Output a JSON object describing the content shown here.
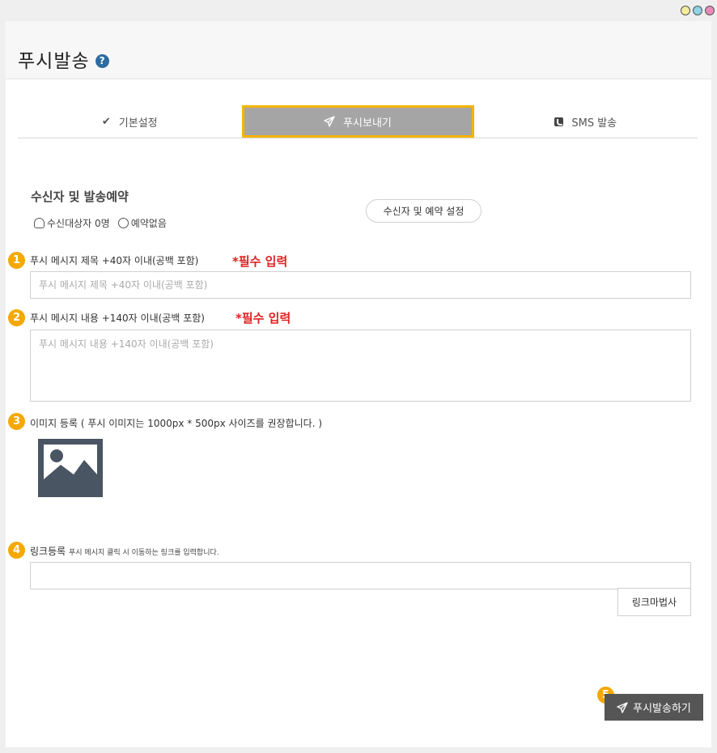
{
  "page": {
    "title": "푸시발송",
    "help_icon": "question-circle-icon"
  },
  "tabs": [
    {
      "label": "기본설정",
      "icon": "check-icon",
      "active": false
    },
    {
      "label": "푸시보내기",
      "icon": "paper-plane-icon",
      "active": true
    },
    {
      "label": "SMS 발송",
      "icon": "phone-icon",
      "active": false
    }
  ],
  "recipients": {
    "title": "수신자 및 발송예약",
    "target_count": "수신대상자 0명",
    "reservation": "예약없음",
    "settings_button": "수신자 및 예약 설정"
  },
  "fields": {
    "title": {
      "badge": "1",
      "label": "푸시 메시지 제목 +40자 이내(공백 포함)",
      "required": "*필수 입력",
      "placeholder": "푸시 메시지 제목 +40자 이내(공백 포함)",
      "value": ""
    },
    "content": {
      "badge": "2",
      "label": "푸시 메시지 내용 +140자 이내(공백 포함)",
      "required": "*필수 입력",
      "placeholder": "푸시 메시지 내용 +140자 이내(공백 포함)",
      "value": ""
    },
    "image": {
      "badge": "3",
      "label": "이미지 등록 ( 푸시 이미지는 1000px * 500px 사이즈를 권장합니다. )"
    },
    "link": {
      "badge": "4",
      "label": "링크등록",
      "hint": "푸시 메시지 클릭 시 이동하는 링크를 입력합니다.",
      "value": "",
      "wizard_button": "링크마법사"
    }
  },
  "send": {
    "badge": "5",
    "label": "푸시발송하기"
  },
  "colors": {
    "accent": "#f5a800",
    "required": "#e02020",
    "active_tab": "#a5a5a5",
    "tab_border": "#f5b400"
  }
}
